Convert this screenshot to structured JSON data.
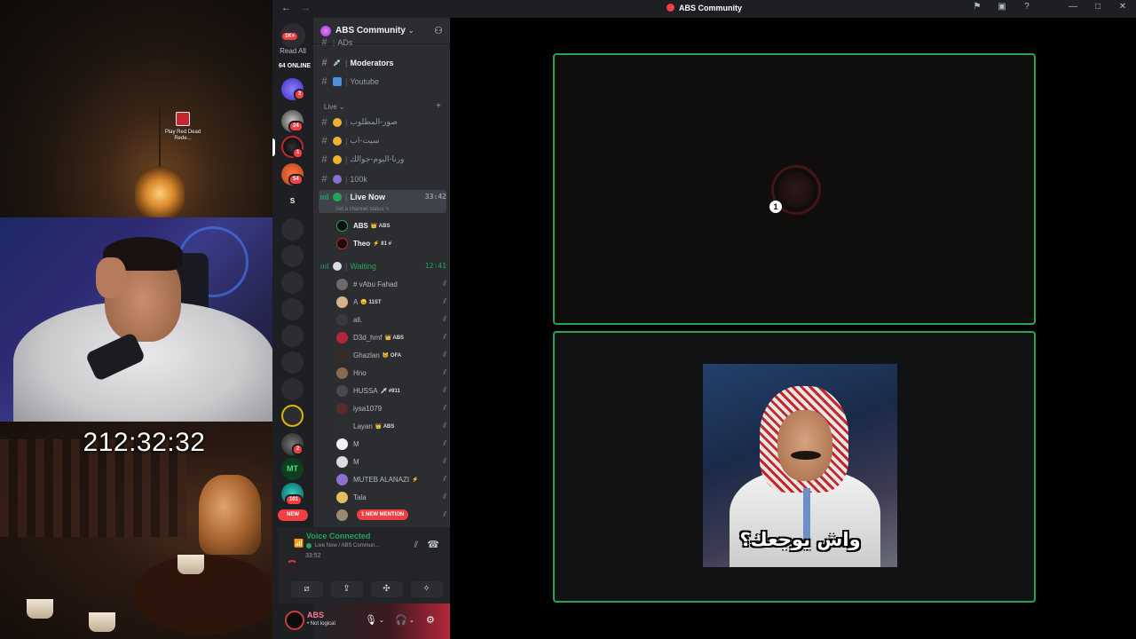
{
  "window": {
    "title": "ABS Community"
  },
  "desktop": {
    "shortcut_label": "Play Red Dead Rede..."
  },
  "stream": {
    "timer": "212:32:32"
  },
  "guild_bar": {
    "home_badge": "1K+",
    "read_all": "Read All",
    "online": "64 ONLINE",
    "badges": [
      "2",
      "24",
      "1",
      "54",
      "2",
      "101"
    ],
    "letter_server": "S",
    "new_label": "NEW"
  },
  "server": {
    "name": "ABS Community",
    "channels_top": [
      {
        "name": "ADs",
        "icon": "cut-off-icon"
      },
      {
        "name": "Moderators",
        "icon": "syringe-icon",
        "bold": true
      },
      {
        "name": "Youtube",
        "icon": "tv-icon"
      }
    ],
    "category": "Live",
    "channels_live": [
      {
        "name": "صور-المطلوب",
        "icon": "emoji-icon"
      },
      {
        "name": "سيت-اب",
        "icon": "emoji-icon"
      },
      {
        "name": "ورنا-اليوم-جوالك",
        "icon": "emoji-icon"
      },
      {
        "name": "100k",
        "icon": "trophy-icon"
      }
    ],
    "voice_live": {
      "name": "Live Now",
      "time": "33:42",
      "status_placeholder": "Set a channel status",
      "members": [
        {
          "name": "ABS",
          "tag": "👑 ABS"
        },
        {
          "name": "Theo",
          "tag": "⚡ 81 #"
        }
      ]
    },
    "voice_waiting": {
      "name": "Waiting",
      "time": "12:41",
      "members": [
        {
          "name": "# vAbu Fahad",
          "tag": ""
        },
        {
          "name": "A",
          "tag": "😠 11ST"
        },
        {
          "name": "ali.",
          "tag": ""
        },
        {
          "name": "D3d_hmf",
          "tag": "👑 ABS"
        },
        {
          "name": "Ghazlan",
          "tag": "🐱 OFA"
        },
        {
          "name": "Hno",
          "tag": ""
        },
        {
          "name": "HUSSA",
          "tag": "🗡 #911"
        },
        {
          "name": "iysa1079",
          "tag": ""
        },
        {
          "name": "Layan",
          "tag": "👑 ABS"
        },
        {
          "name": "M",
          "tag": ""
        },
        {
          "name": "M",
          "tag": ""
        },
        {
          "name": "MUTEB ALANAZI",
          "tag": "⚡"
        },
        {
          "name": "Tala",
          "tag": ""
        },
        {
          "name": "",
          "tag": "",
          "mention": "1 NEW MENTION"
        }
      ]
    }
  },
  "voice_panel": {
    "connected": "Voice Connected",
    "location": "Live Now / ABS Commun...",
    "time": "33:52"
  },
  "user_panel": {
    "name": "ABS",
    "status": "• Not logical"
  },
  "stage": {
    "meme_caption": "واش يوجعك؟",
    "participant_badge": "1"
  },
  "colors": {
    "accent_green": "#23a55a",
    "danger": "#f23f42",
    "tile_border": "#2aa253"
  }
}
